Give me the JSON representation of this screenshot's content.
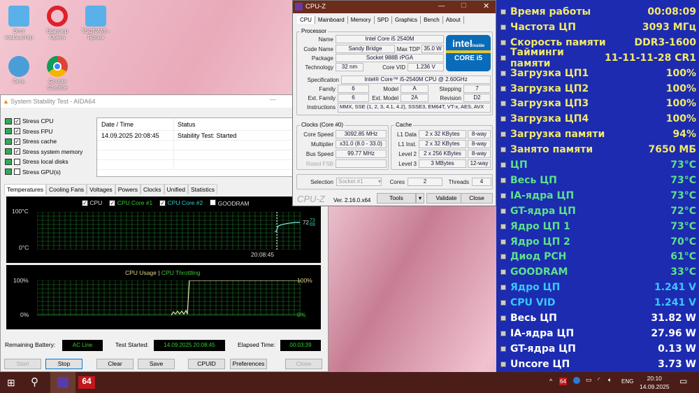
{
  "desktop": {
    "icons": [
      "Этот компьютер",
      "Браузер Opera",
      "TSUNAMI - Ярлык",
      "Сеть",
      "Google Chrome"
    ]
  },
  "aida": {
    "title": "System Stability Test - AIDA64",
    "stress": [
      {
        "label": "Stress CPU",
        "checked": true
      },
      {
        "label": "Stress FPU",
        "checked": true
      },
      {
        "label": "Stress cache",
        "checked": true
      },
      {
        "label": "Stress system memory",
        "checked": true
      },
      {
        "label": "Stress local disks",
        "checked": false
      },
      {
        "label": "Stress GPU(s)",
        "checked": false
      }
    ],
    "log": {
      "headers": [
        "Date / Time",
        "Status"
      ],
      "rows": [
        [
          "14.09.2025 20:08:45",
          "Stability Test: Started"
        ]
      ]
    },
    "tabs": [
      "Temperatures",
      "Cooling Fans",
      "Voltages",
      "Powers",
      "Clocks",
      "Unified",
      "Statistics"
    ],
    "temp_graph": {
      "legend": [
        "CPU",
        "CPU Core #1",
        "CPU Core #2",
        "GOODRAM"
      ],
      "legend_checked": [
        true,
        true,
        true,
        false
      ],
      "ymax_label": "100°C",
      "ymin_label": "0°C",
      "time_label": "20:08:45",
      "values_end": [
        "72",
        "73",
        "69"
      ],
      "series": [
        48,
        49,
        62,
        64,
        66,
        67,
        68,
        69,
        70,
        70,
        71,
        71,
        72,
        72,
        72,
        72
      ]
    },
    "usage_graph": {
      "title_usage": "CPU Usage",
      "sep": "|",
      "title_throttle": "CPU Throttling",
      "left_max": "100%",
      "left_min": "0%",
      "right_max": "100%",
      "right_min": "0%"
    },
    "status": {
      "battery_label": "Remaining Battery:",
      "battery": "AC Line",
      "started_label": "Test Started:",
      "started": "14.09.2025 20:08:45",
      "elapsed_label": "Elapsed Time:",
      "elapsed": "00:03:39"
    },
    "buttons": [
      "Start",
      "Stop",
      "Clear",
      "Save",
      "CPUID",
      "Preferences",
      "Close"
    ]
  },
  "cpuz": {
    "title": "CPU-Z",
    "tabs": [
      "CPU",
      "Mainboard",
      "Memory",
      "SPD",
      "Graphics",
      "Bench",
      "About"
    ],
    "processor_label": "Processor",
    "name_l": "Name",
    "name": "Intel Core i5 2540M",
    "code_l": "Code Name",
    "code": "Sandy Bridge",
    "tdp_l": "Max TDP",
    "tdp": "35.0 W",
    "pkg_l": "Package",
    "pkg": "Socket 988B rPGA",
    "tech_l": "Technology",
    "tech": "32 nm",
    "vid_l": "Core VID",
    "vid": "1.236 V",
    "spec_l": "Specification",
    "spec": "Intel® Core™ i5-2540M CPU @ 2.60GHz",
    "fam_l": "Family",
    "fam": "6",
    "model_l": "Model",
    "model": "A",
    "step_l": "Stepping",
    "step": "7",
    "efam_l": "Ext. Family",
    "efam": "6",
    "emodel_l": "Ext. Model",
    "emodel": "2A",
    "rev_l": "Revision",
    "rev": "D2",
    "instr_l": "Instructions",
    "instr": "MMX, SSE (1, 2, 3, 4.1, 4.2), SSSE3, EM64T, VT-x, AES, AVX",
    "logo_brand": "intel",
    "logo_inside": "inside",
    "logo_model": "CORE i5",
    "clocks_label": "Clocks (Core #0)",
    "cs_l": "Core Speed",
    "cs": "3092.85 MHz",
    "mul_l": "Multiplier",
    "mul": "x31.0 (8.0 - 33.0)",
    "bus_l": "Bus Speed",
    "bus": "99.77 MHz",
    "fsb_l": "Rated FSB",
    "cache_label": "Cache",
    "cache": [
      [
        "L1 Data",
        "2 x 32 KBytes",
        "8-way"
      ],
      [
        "L1 Inst.",
        "2 x 32 KBytes",
        "8-way"
      ],
      [
        "Level 2",
        "2 x 256 KBytes",
        "8-way"
      ],
      [
        "Level 3",
        "3 MBytes",
        "12-way"
      ]
    ],
    "sel_l": "Selection",
    "sel": "Socket #1",
    "cores_l": "Cores",
    "cores": "2",
    "threads_l": "Threads",
    "threads": "4",
    "brand": "CPU-Z",
    "ver": "Ver. 2.16.0.x64",
    "tools": "Tools",
    "validate": "Validate",
    "close": "Close"
  },
  "sensors": [
    {
      "l": "Время работы",
      "v": "00:08:09",
      "c": "y"
    },
    {
      "l": "Частота ЦП",
      "v": "3093 МГц",
      "c": "y"
    },
    {
      "l": "Скорость памяти",
      "v": "DDR3-1600",
      "c": "y"
    },
    {
      "l": "Тайминги памяти",
      "v": "11-11-11-28 CR1",
      "c": "y"
    },
    {
      "l": "Загрузка ЦП1",
      "v": "100%",
      "c": "y"
    },
    {
      "l": "Загрузка ЦП2",
      "v": "100%",
      "c": "y"
    },
    {
      "l": "Загрузка ЦП3",
      "v": "100%",
      "c": "y"
    },
    {
      "l": "Загрузка ЦП4",
      "v": "100%",
      "c": "y"
    },
    {
      "l": "Загрузка памяти",
      "v": "94%",
      "c": "y"
    },
    {
      "l": "Занято памяти",
      "v": "7650 МБ",
      "c": "y"
    },
    {
      "l": "ЦП",
      "v": "73°C",
      "c": "g"
    },
    {
      "l": "Весь ЦП",
      "v": "73°C",
      "c": "g"
    },
    {
      "l": "IA-ядра ЦП",
      "v": "73°C",
      "c": "g"
    },
    {
      "l": "GT-ядра ЦП",
      "v": "72°C",
      "c": "g"
    },
    {
      "l": "Ядро ЦП 1",
      "v": "73°C",
      "c": "g"
    },
    {
      "l": "Ядро ЦП 2",
      "v": "70°C",
      "c": "g"
    },
    {
      "l": "Диод PCH",
      "v": "61°C",
      "c": "g"
    },
    {
      "l": "GOODRAM",
      "v": "33°C",
      "c": "g"
    },
    {
      "l": "Ядро ЦП",
      "v": "1.241 V",
      "c": "b"
    },
    {
      "l": "CPU VID",
      "v": "1.241 V",
      "c": "b"
    },
    {
      "l": "Весь ЦП",
      "v": "31.82 W",
      "c": "w"
    },
    {
      "l": "IA-ядра ЦП",
      "v": "27.96 W",
      "c": "w"
    },
    {
      "l": "GT-ядра ЦП",
      "v": "0.13 W",
      "c": "w"
    },
    {
      "l": "Uncore ЦП",
      "v": "3.73 W",
      "c": "w"
    }
  ],
  "taskbar": {
    "aida_badge": "64",
    "tray_badge": "64",
    "lang": "ENG",
    "time": "20:10",
    "date": "14.09.2025"
  }
}
